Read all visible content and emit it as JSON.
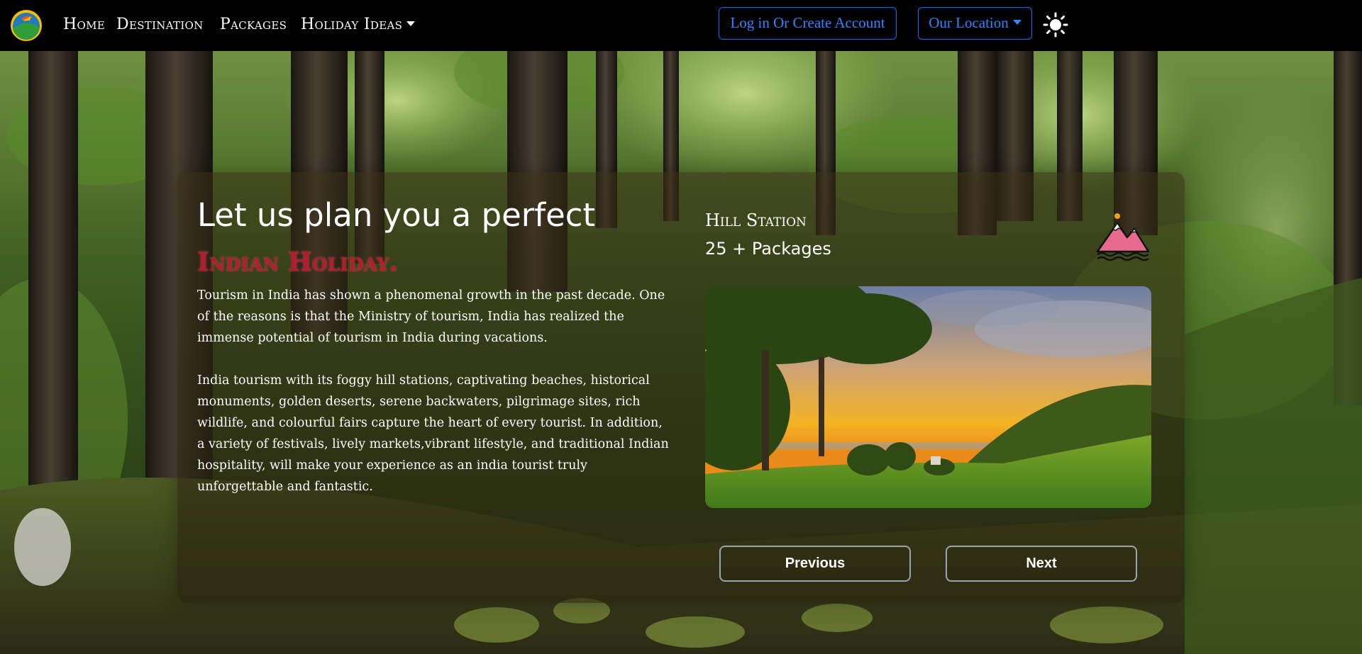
{
  "nav": {
    "links": [
      {
        "label": "Home"
      },
      {
        "label": "Destination"
      },
      {
        "label": "Packages"
      },
      {
        "label": "Holiday Ideas"
      }
    ],
    "login_label": "Log in Or Create Account",
    "location_label": "Our Location"
  },
  "hero": {
    "title_lead": "Let us plan you a perfect ",
    "title_highlight": "Indian Holiday.",
    "paragraph1": "Tourism in India has shown a phenomenal growth in the past decade. One of the reasons is that the Ministry of tourism, India has realized the immense potential of tourism in India during vacations.",
    "paragraph2": "India tourism with its foggy hill stations, captivating beaches, historical monuments, golden deserts, serene backwaters, pilgrimage sites, rich wildlife, and colourful fairs capture the heart of every tourist. In addition, a variety of festivals, lively markets,vibrant lifestyle, and traditional Indian hospitality, will make your experience as an india tourist truly unforgettable and fantastic."
  },
  "slide": {
    "category": "Hill Station",
    "count": "25 + Packages",
    "icon": "mountain-icon",
    "previous_label": "Previous",
    "next_label": "Next"
  },
  "colors": {
    "accent": "#0d6efd",
    "highlight": "#b41d2e",
    "navbar_bg": "#000000"
  }
}
